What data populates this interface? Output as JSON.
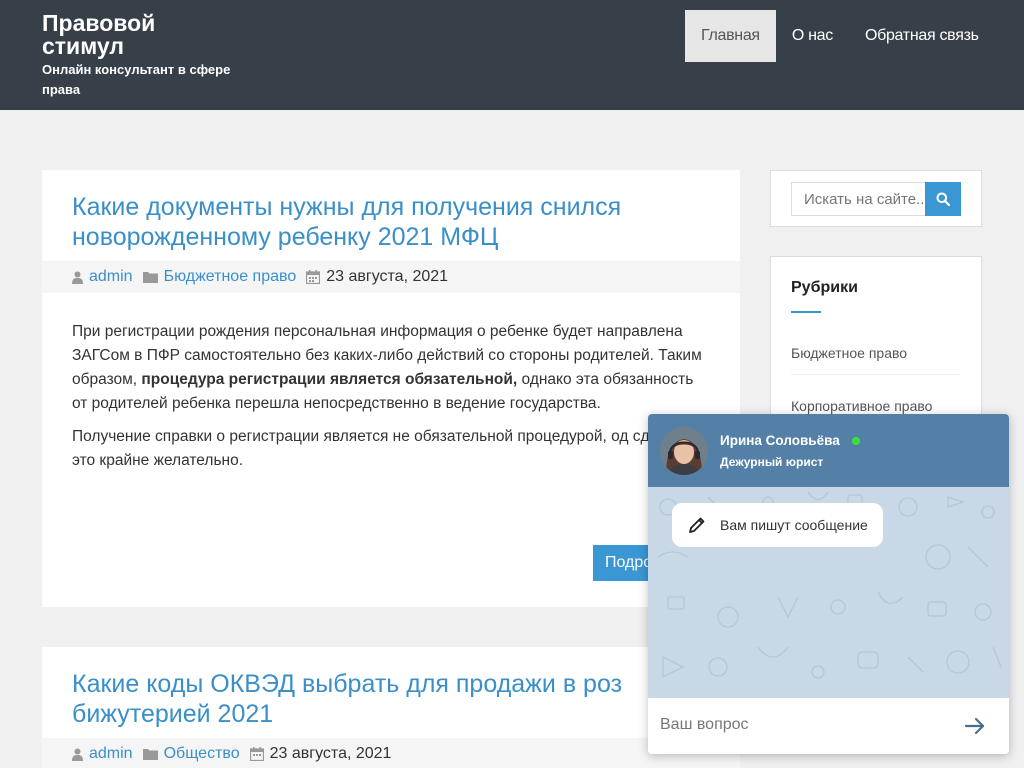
{
  "header": {
    "title": "Правовой стимул",
    "tagline": "Онлайн консультант в сфере права",
    "nav": [
      {
        "label": "Главная",
        "active": true
      },
      {
        "label": "О нас",
        "active": false
      },
      {
        "label": "Обратная связь",
        "active": false
      }
    ]
  },
  "posts": [
    {
      "title": "Какие документы нужны для получения снился новорожденному ребенку 2021 МФЦ",
      "author": "admin",
      "category": "Бюджетное право",
      "date": "23 августа, 2021",
      "p1_a": "При регистрации рождения персональная информация о ребенке будет направлена ЗАГСом в ПФР самостоятельно без каких-либо действий со стороны родителей. Таким образом, ",
      "p1_bold": "процедура регистрации является обязательной,",
      "p1_b": " однако эта обязанность от родителей ребенка перешла непосредственно в ведение государства.",
      "p2": "Получение справки о регистрации является не обязательной процедурой, од сделать это крайне желательно.",
      "more_label": "Подро"
    },
    {
      "title": "Какие коды ОКВЭД выбрать для продажи в роз бижутерией 2021",
      "author": "admin",
      "category": "Общество",
      "date": "23 августа, 2021"
    }
  ],
  "sidebar": {
    "search_placeholder": "Искать на сайте...",
    "rubrics_title": "Рубрики",
    "categories": [
      "Бюджетное право",
      "Корпоративное право"
    ]
  },
  "chat": {
    "name": "Ирина Соловьёва",
    "role": "Дежурный юрист",
    "typing": "Вам пишут сообщение",
    "input_placeholder": "Ваш вопрос",
    "colors": {
      "header": "#5480a8",
      "online": "#3ae03a"
    }
  },
  "icons": [
    "user-icon",
    "folder-icon",
    "calendar-icon",
    "search-icon",
    "pencil-icon",
    "arrow-right-icon"
  ]
}
